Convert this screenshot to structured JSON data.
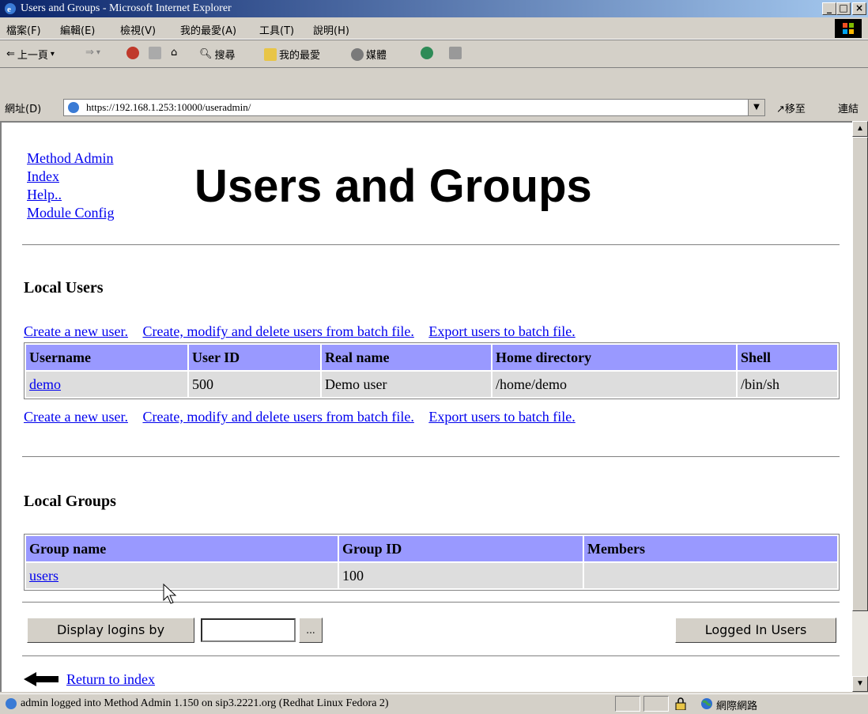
{
  "window": {
    "title": "Users and Groups - Microsoft Internet Explorer",
    "buttons": [
      "_",
      "□",
      "×"
    ]
  },
  "menu": [
    "檔案(F)",
    "編輯(E)",
    "檢視(V)",
    "我的最愛(A)",
    "工具(T)",
    "說明(H)"
  ],
  "toolbar": {
    "back": "上一頁",
    "search": "搜尋",
    "favorites": "我的最愛",
    "media": "媒體"
  },
  "address": {
    "label": "網址(D)",
    "url": "https://192.168.1.253:10000/useradmin/",
    "go": "移至",
    "links": "連結"
  },
  "page": {
    "toplinks": [
      "Method Admin",
      "Index",
      "Help..",
      "Module Config"
    ],
    "title": "Users and Groups",
    "users": {
      "heading": "Local Users",
      "actions": [
        "Create a new user.",
        "Create, modify and delete users from batch file.",
        "Export users to batch file."
      ],
      "columns": [
        "Username",
        "User ID",
        "Real name",
        "Home directory",
        "Shell"
      ],
      "rows": [
        [
          "demo",
          "500",
          "Demo user",
          "/home/demo",
          "/bin/sh"
        ]
      ]
    },
    "groups": {
      "heading": "Local Groups",
      "columns": [
        "Group name",
        "Group ID",
        "Members"
      ],
      "rows": [
        [
          "users",
          "100",
          ""
        ]
      ]
    },
    "display_logins_label": "Display logins by",
    "display_logins_value": "",
    "browse_label": "...",
    "logged_in_label": "Logged In Users",
    "return_label": "Return to index"
  },
  "status": {
    "text": "admin logged into Method Admin 1.150 on sip3.2221.org (Redhat Linux Fedora 2)",
    "zone": "網際網路"
  }
}
